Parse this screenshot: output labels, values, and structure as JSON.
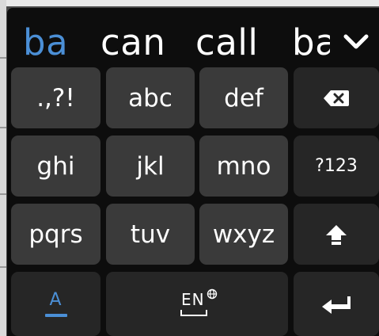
{
  "suggestions": {
    "primary": "ba",
    "second": "can",
    "third": "call",
    "partial": "ba"
  },
  "keys": {
    "row1": {
      "punct": ".,?!",
      "abc": "abc",
      "def": "def"
    },
    "row2": {
      "ghi": "ghi",
      "jkl": "jkl",
      "mno": "mno",
      "symbols": "?123"
    },
    "row3": {
      "pqrs": "pqrs",
      "tuv": "tuv",
      "wxyz": "wxyz"
    },
    "row4": {
      "language": "EN"
    }
  },
  "icons": {
    "collapse": "chevron-down-icon",
    "backspace": "backspace-icon",
    "shift": "shift-icon",
    "input_mode": "text-mode-a-icon",
    "language": "globe-icon",
    "enter": "enter-icon"
  },
  "colors": {
    "accent": "#4b8fd6",
    "keyboard_bg": "#0d0d0d",
    "letter_key": "#3a3a3a",
    "function_key": "#262626"
  }
}
